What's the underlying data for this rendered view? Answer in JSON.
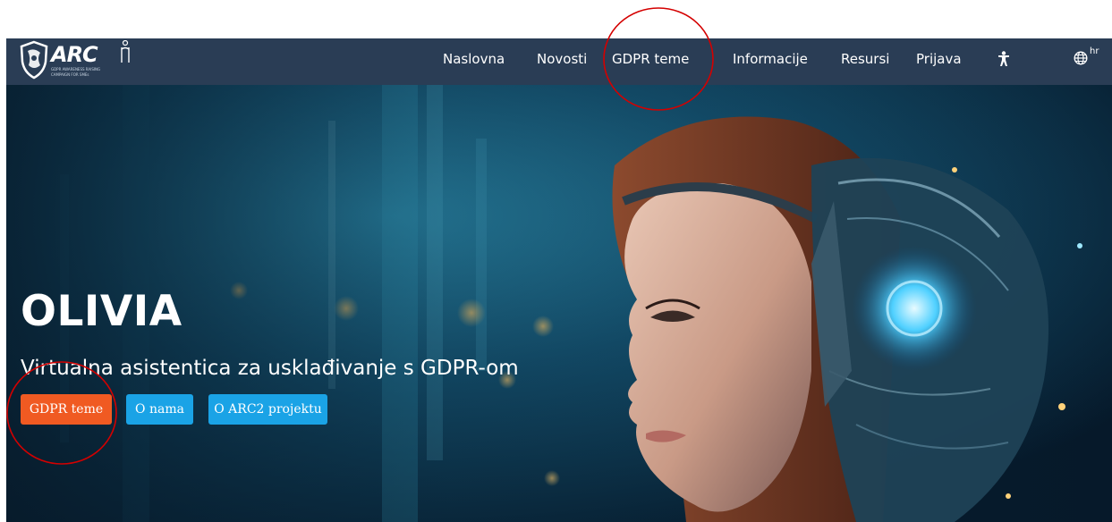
{
  "logo": {
    "name": "ARC",
    "subtitle_line1": "GDPR AWARENESS RAISING",
    "subtitle_line2": "CAMPAIGN FOR SMEs"
  },
  "nav": {
    "items": [
      {
        "label": "Naslovna"
      },
      {
        "label": "Novosti"
      },
      {
        "label": "GDPR teme"
      },
      {
        "label": "Informacije"
      },
      {
        "label": "Resursi"
      },
      {
        "label": "Prijava"
      }
    ],
    "accessibility_icon": "accessibility-icon",
    "language_icon": "globe-icon",
    "language": "hr"
  },
  "hero": {
    "title": "OLIVIA",
    "subtitle": "Virtualna asistentica za usklađivanje s GDPR-om",
    "buttons": [
      {
        "label": "GDPR teme",
        "color": "#f05a22"
      },
      {
        "label": "O nama",
        "color": "#1aa3e6"
      },
      {
        "label": "O ARC2 projektu",
        "color": "#1aa3e6"
      }
    ],
    "background_image": "woman-with-robotic-headset"
  },
  "colors": {
    "navbar": "#2a3d55",
    "annotation_circle": "#d40000"
  }
}
